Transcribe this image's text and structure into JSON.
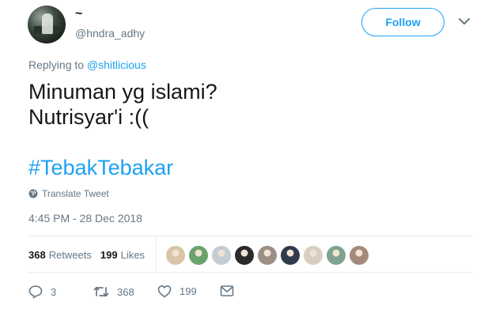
{
  "author": {
    "display_name": "~",
    "handle": "@hndra_adhy"
  },
  "follow_label": "Follow",
  "reply": {
    "prefix": "Replying to",
    "mention": "@shitlicious"
  },
  "tweet": {
    "line1": "Minuman yg islami?",
    "line2": "Nutrisyar'i :((",
    "hashtag": "#TebakTebakar"
  },
  "translate_label": "Translate Tweet",
  "timestamp": "4:45 PM - 28 Dec 2018",
  "stats": {
    "retweets_count": "368",
    "retweets_label": "Retweets",
    "likes_count": "199",
    "likes_label": "Likes"
  },
  "liker_colors": [
    "#d9c6a8",
    "#6aa36b",
    "#c5ccd2",
    "#2b2b2b",
    "#9b8f86",
    "#2f3a4a",
    "#d8cfc0",
    "#7fa390",
    "#a38a7a"
  ],
  "actions": {
    "replies": "3",
    "retweets": "368",
    "likes": "199"
  },
  "colors": {
    "accent": "#1da1f2",
    "muted": "#657786",
    "text": "#14171a"
  }
}
